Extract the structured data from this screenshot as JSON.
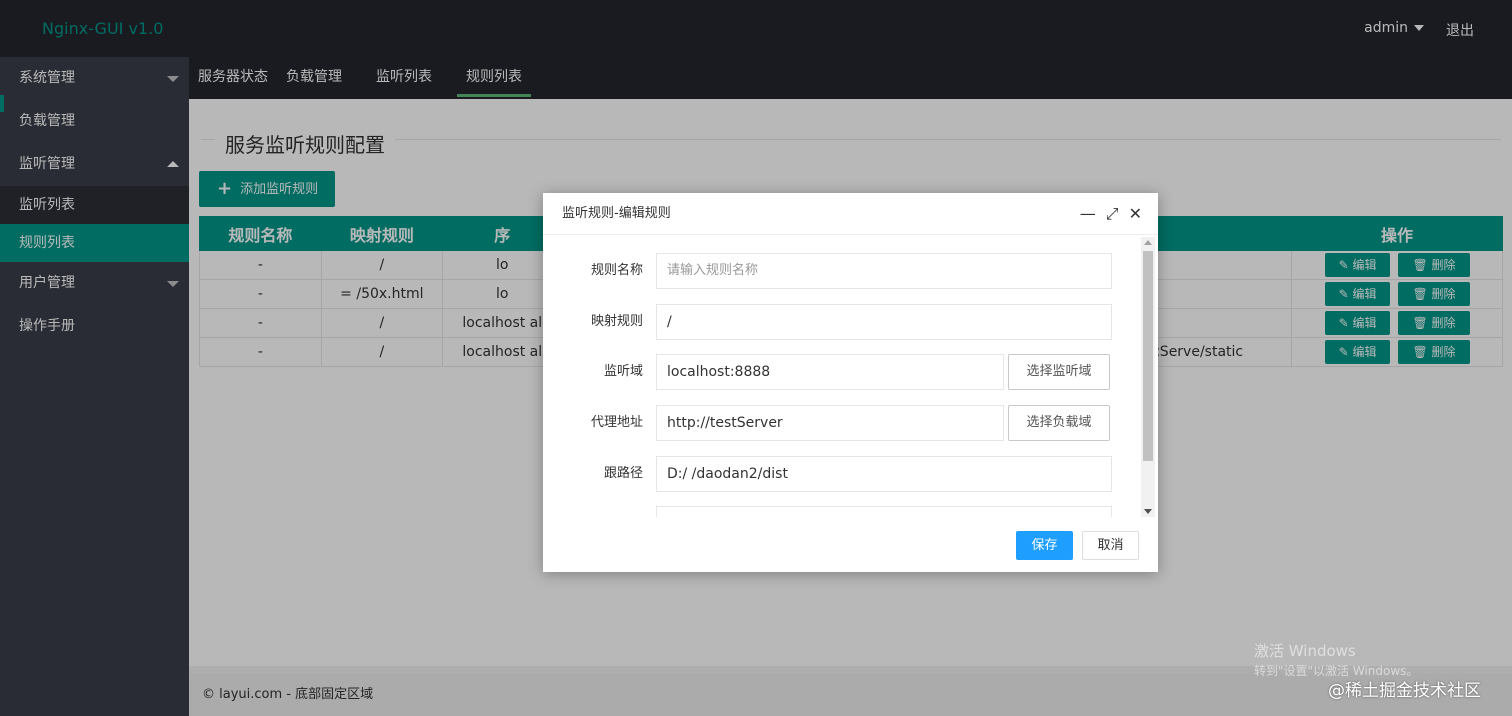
{
  "app": {
    "title": "Nginx-GUI v1.0"
  },
  "header": {
    "user": "admin",
    "logout": "退出"
  },
  "sidebar": {
    "items": [
      {
        "label": "系统管理"
      },
      {
        "label": "负载管理"
      },
      {
        "label": "监听管理"
      },
      {
        "label": "监听列表"
      },
      {
        "label": "规则列表"
      },
      {
        "label": "用户管理"
      },
      {
        "label": "操作手册"
      }
    ]
  },
  "tabs": [
    {
      "label": "服务器状态"
    },
    {
      "label": "负载管理"
    },
    {
      "label": "监听列表"
    },
    {
      "label": "规则列表"
    }
  ],
  "page": {
    "title": "服务监听规则配置",
    "add_button": "添加监听规则"
  },
  "table": {
    "headers": [
      "规则名称",
      "映射规则",
      "序",
      "操作"
    ],
    "rows": [
      [
        "-",
        "/",
        "lo",
        ""
      ],
      [
        "-",
        "= /50x.html",
        "lo",
        ""
      ],
      [
        "-",
        "/",
        "localhost al",
        ""
      ],
      [
        "-",
        "/",
        "localhost al",
        "icServe/static"
      ]
    ],
    "edit_label": "编辑",
    "delete_label": "删除"
  },
  "dialog": {
    "title": "监听规则-编辑规则",
    "fields": {
      "name_label": "规则名称",
      "name_placeholder": "请输入规则名称",
      "map_label": "映射规则",
      "map_value": "/",
      "listen_label": "监听域",
      "listen_value": "localhost:8888",
      "listen_btn": "选择监听域",
      "proxy_label": "代理地址",
      "proxy_value": "http://testServer",
      "proxy_btn": "选择负载域",
      "path_label": "跟路径",
      "path_value": "D:/ /daodan2/dist"
    },
    "save": "保存",
    "cancel": "取消"
  },
  "footer": {
    "text": "© layui.com - 底部固定区域"
  },
  "watermark": {
    "line1": "激活 Windows",
    "line2": "转到\"设置\"以激活 Windows。",
    "line3": "@稀土掘金技术社区"
  }
}
